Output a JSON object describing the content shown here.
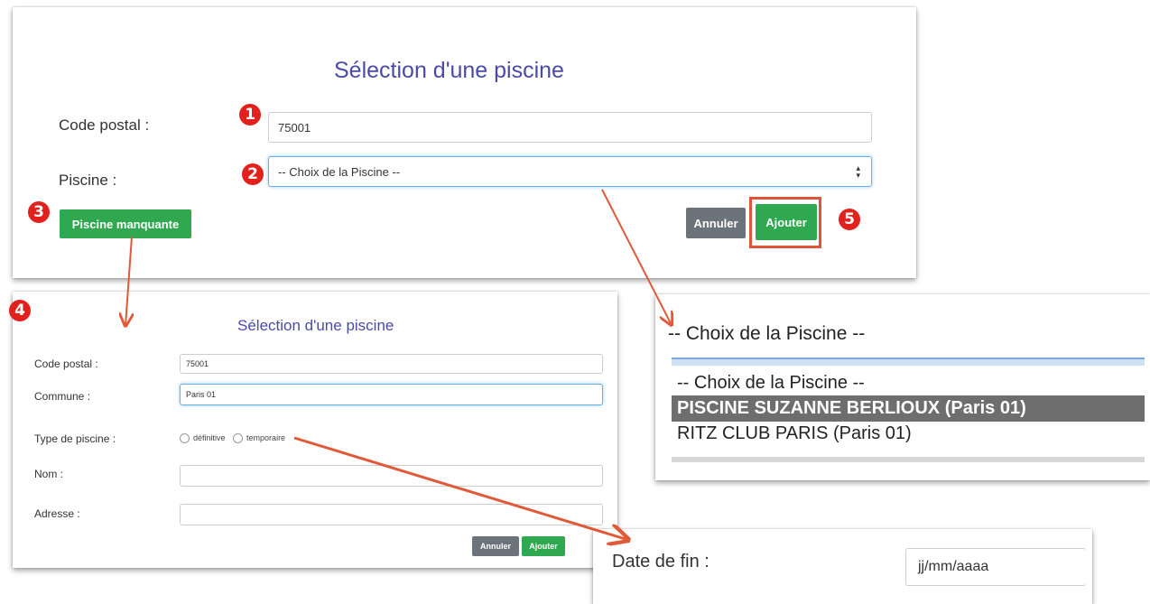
{
  "main_form": {
    "title": "Sélection d'une piscine",
    "code_postal_label": "Code postal :",
    "code_postal_value": "75001",
    "piscine_label": "Piscine :",
    "piscine_select_value": "-- Choix de la Piscine --",
    "missing_pool_button": "Piscine manquante",
    "cancel_button": "Annuler",
    "add_button": "Ajouter"
  },
  "badges": [
    "1",
    "2",
    "3",
    "4",
    "5"
  ],
  "missing_form": {
    "title": "Sélection d'une piscine",
    "code_postal_label": "Code postal :",
    "code_postal_value": "75001",
    "commune_label": "Commune :",
    "commune_value": "Paris 01",
    "type_label": "Type de piscine :",
    "type_option_1": "définitive",
    "type_option_2": "temporaire",
    "nom_label": "Nom :",
    "adresse_label": "Adresse :",
    "cancel_button": "Annuler",
    "add_button": "Ajouter"
  },
  "dropdown_zoom": {
    "selected_value": "-- Choix de la Piscine --",
    "options": [
      "-- Choix de la Piscine --",
      "PISCINE SUZANNE BERLIOUX (Paris 01)",
      "RITZ CLUB PARIS (Paris 01)"
    ]
  },
  "date_zoom": {
    "label": "Date de fin :",
    "placeholder": "jj/mm/aaaa"
  },
  "colors": {
    "title": "#4a4aa8",
    "green_button": "#2fa84f",
    "gray_button": "#6c737b",
    "badge": "#e2211c",
    "arrow": "#e05a3a",
    "highlight_option": "#6e6e6e"
  }
}
